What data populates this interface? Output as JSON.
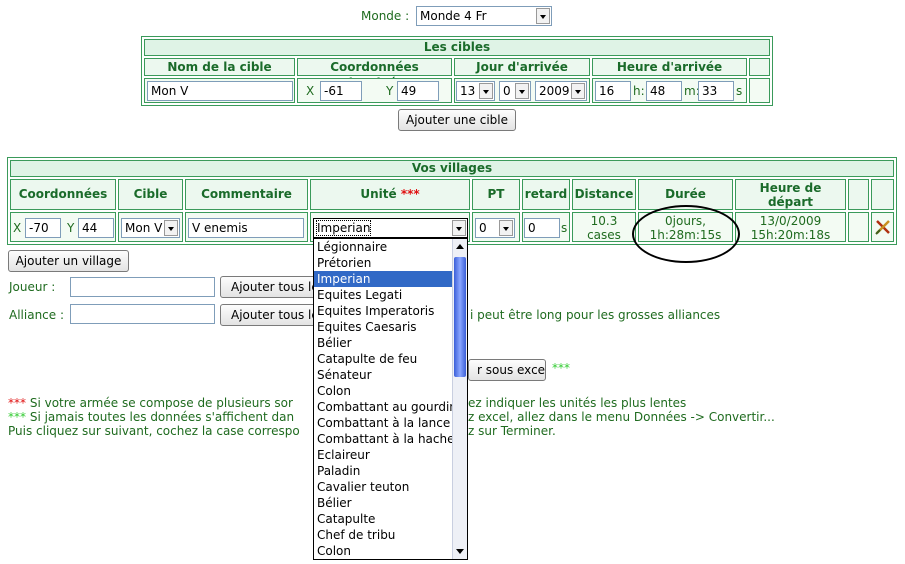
{
  "monde": {
    "label": "Monde :",
    "value": "Monde 4 Fr"
  },
  "cibles": {
    "title": "Les cibles",
    "headers": [
      "Nom de la cible",
      "Coordonnées d'arrivée",
      "Jour d'arrivée",
      "Heure d'arrivée"
    ],
    "row": {
      "nom": "Mon V",
      "x_label": "X",
      "x": "-61",
      "y_label": "Y",
      "y": "49",
      "jour": "13",
      "mois": "0",
      "annee": "2009",
      "heure": "16",
      "h_label": "h:",
      "minute": "48",
      "m_label": "m:",
      "seconde": "33",
      "s_label": "s"
    },
    "add_button": "Ajouter une cible"
  },
  "villages": {
    "title": "Vos villages",
    "headers": {
      "coord": "Coordonnées",
      "cible": "Cible",
      "commentaire": "Commentaire",
      "unite": "Unité",
      "unite_mark": "***",
      "pt": "PT",
      "retard": "retard",
      "distance": "Distance",
      "duree": "Durée",
      "depart_line1": "Heure de",
      "depart_line2": "départ"
    },
    "row": {
      "x_label": "X",
      "x": "-70",
      "y_label": "Y",
      "y": "44",
      "cible": "Mon V",
      "commentaire": "V enemis",
      "unite": "Imperian",
      "pt": "0",
      "retard": "0",
      "retard_unit": "s",
      "distance_line1": "10.3",
      "distance_line2": "cases",
      "duree_line1": "0jours,",
      "duree_line2": "1h:28m:15s",
      "depart_line1": "13/0/2009",
      "depart_line2": "15h:20m:18s"
    },
    "add_button": "Ajouter un village"
  },
  "joueur": {
    "label": "Joueur :",
    "button": "Ajouter tous le"
  },
  "alliance": {
    "label": "Alliance :",
    "button": "Ajouter tous le",
    "note": "i peut être long pour les grosses alliances"
  },
  "excel": {
    "button": "r sous excel",
    "mark": "***"
  },
  "notes": {
    "line1_mark": "***",
    "line1": "Si votre armée se compose de plusieurs sor",
    "line1_tail": "ez indiquer les unités les plus lentes",
    "line2_mark": "***",
    "line2": "Si jamais toutes les données s'affichent dan",
    "line2_tail": "z excel, allez dans le menu Données -> Convertir...",
    "line3": "Puis cliquez sur suivant, cochez la case correspo",
    "line3_tail": "z sur Terminer."
  },
  "unit_options": [
    "Légionnaire",
    "Prétorien",
    "Imperian",
    "Equites Legati",
    "Equites Imperatoris",
    "Equites Caesaris",
    "Bélier",
    "Catapulte de feu",
    "Sénateur",
    "Colon",
    "Combattant au gourdin",
    "Combattant à la lance",
    "Combattant à la hache",
    "Eclaireur",
    "Paladin",
    "Cavalier teuton",
    "Bélier",
    "Catapulte",
    "Chef de tribu",
    "Colon"
  ],
  "colors": {
    "frame": "#3a9a5a",
    "text": "#1f6b1f",
    "selected": "#3169c6",
    "mark_red": "#e01010",
    "mark_green": "#33cc33"
  }
}
